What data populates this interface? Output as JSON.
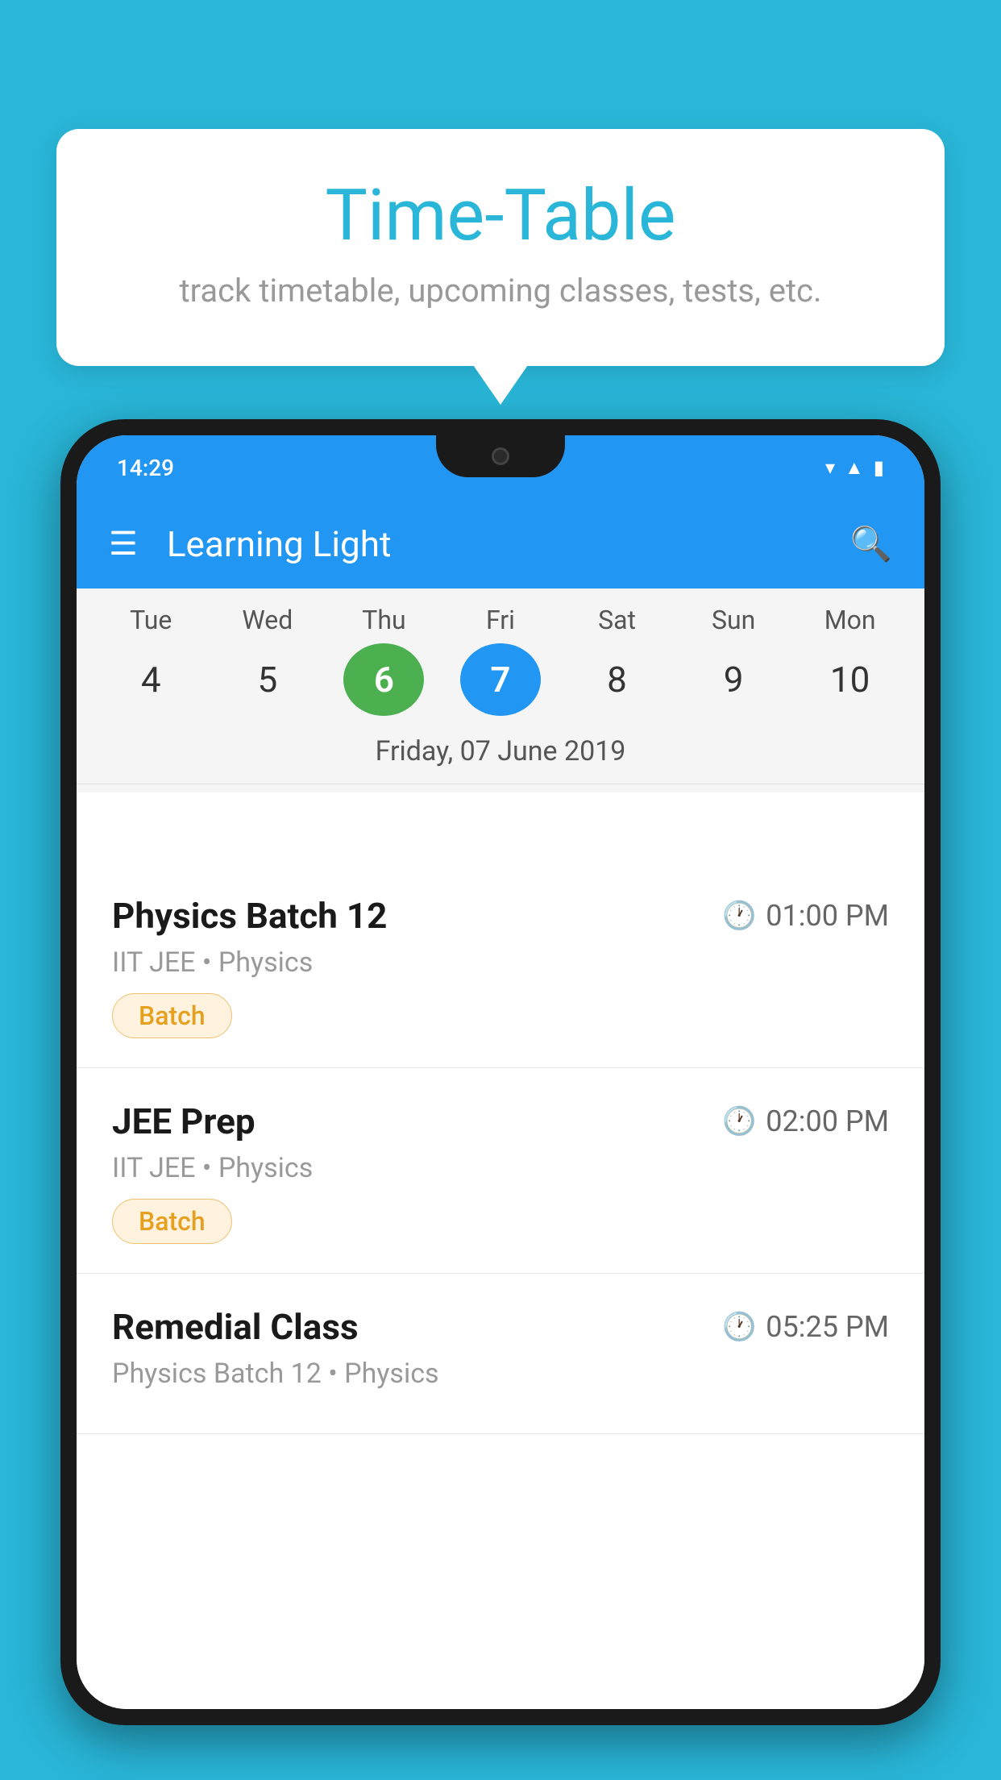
{
  "background_color": "#29b6d8",
  "tooltip": {
    "title": "Time-Table",
    "subtitle": "track timetable, upcoming classes, tests, etc."
  },
  "phone": {
    "status_bar": {
      "time": "14:29"
    },
    "app_bar": {
      "title": "Learning Light"
    },
    "calendar": {
      "days": [
        {
          "short": "Tue",
          "num": "4"
        },
        {
          "short": "Wed",
          "num": "5"
        },
        {
          "short": "Thu",
          "num": "6",
          "state": "today"
        },
        {
          "short": "Fri",
          "num": "7",
          "state": "selected"
        },
        {
          "short": "Sat",
          "num": "8"
        },
        {
          "short": "Sun",
          "num": "9"
        },
        {
          "short": "Mon",
          "num": "10"
        }
      ],
      "selected_date_label": "Friday, 07 June 2019"
    },
    "schedule": [
      {
        "title": "Physics Batch 12",
        "time": "01:00 PM",
        "meta": "IIT JEE • Physics",
        "badge": "Batch"
      },
      {
        "title": "JEE Prep",
        "time": "02:00 PM",
        "meta": "IIT JEE • Physics",
        "badge": "Batch"
      },
      {
        "title": "Remedial Class",
        "time": "05:25 PM",
        "meta": "Physics Batch 12 • Physics",
        "badge": null
      }
    ]
  }
}
